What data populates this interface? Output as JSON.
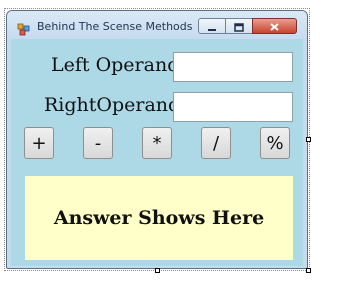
{
  "window": {
    "title": "Behind The Scense Methods",
    "background_color": "#add8e6",
    "icons": {
      "app": "app-icon",
      "minimize": "minimize-icon",
      "maximize": "maximize-icon",
      "close": "close-icon"
    }
  },
  "form": {
    "left_operand_label": "Left Operand",
    "right_operand_label": "RightOperand",
    "left_operand_value": "",
    "right_operand_value": "",
    "operators": [
      "+",
      "-",
      "*",
      "/",
      "%"
    ],
    "answer_text": "Answer Shows Here",
    "answer_background": "#ffffc9"
  }
}
